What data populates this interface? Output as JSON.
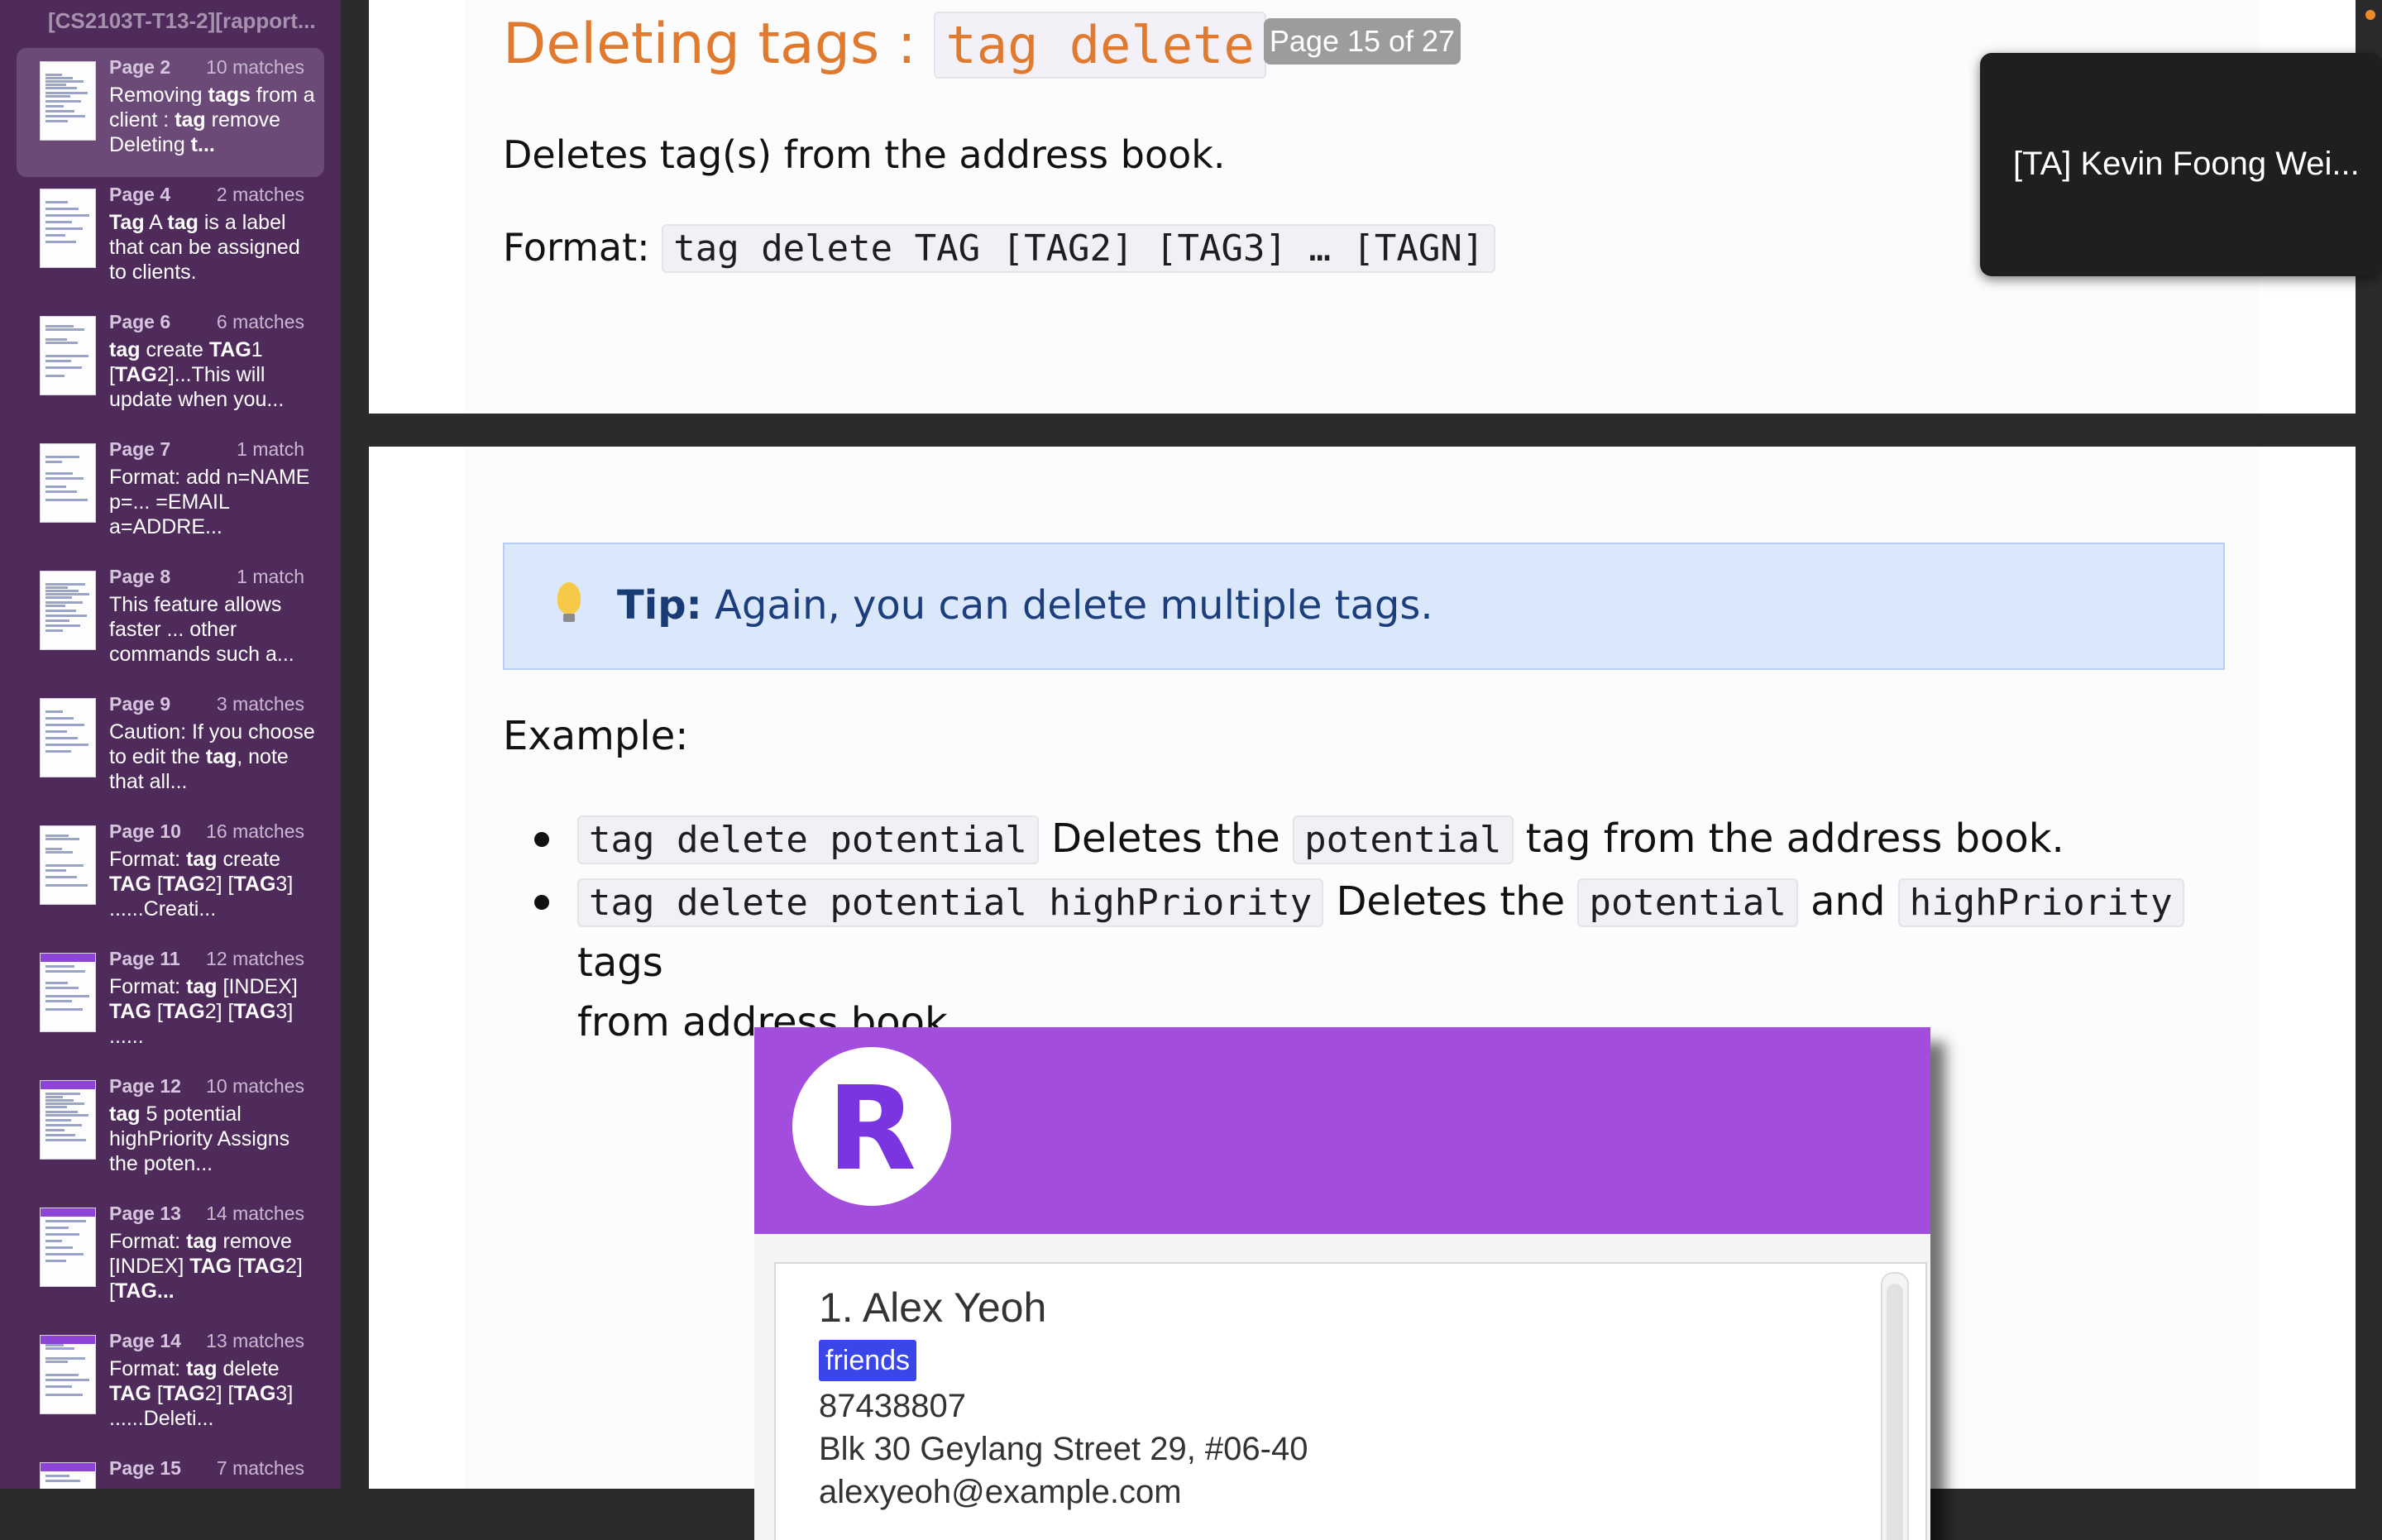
{
  "sidebar": {
    "title": "[CS2103T-T13-2][rapport...",
    "results": [
      {
        "page": "Page 2",
        "count": "10 matches",
        "snippet": "Removing <b>tags</b> from a client : <b>tag</b> remove Deleting <b>t...</b>"
      },
      {
        "page": "Page 4",
        "count": "2 matches",
        "snippet": "<b>Tag</b> A <b>tag</b> is a label that can be assigned to clients."
      },
      {
        "page": "Page 6",
        "count": "6 matches",
        "snippet": "<b>tag</b> create <b>TAG</b>1 [<b>TAG</b>2]...This will update when you..."
      },
      {
        "page": "Page 7",
        "count": "1 match",
        "snippet": "Format: add n=NAME p=... =EMAIL a=ADDRE..."
      },
      {
        "page": "Page 8",
        "count": "1 match",
        "snippet": "This feature allows faster ... other commands such a..."
      },
      {
        "page": "Page 9",
        "count": "3 matches",
        "snippet": "Caution: If you choose to edit the <b>tag</b>, note that all..."
      },
      {
        "page": "Page 10",
        "count": "16 matches",
        "snippet": "Format: <b>tag</b> create <b>TAG</b> [<b>TAG</b>2] [<b>TAG</b>3] ......Creati..."
      },
      {
        "page": "Page 11",
        "count": "12 matches",
        "snippet": "Format: <b>tag</b> [INDEX] <b>TAG</b> [<b>TAG</b>2] [<b>TAG</b>3] ......"
      },
      {
        "page": "Page 12",
        "count": "10 matches",
        "snippet": "<b>tag</b> 5 potential highPriority Assigns the poten..."
      },
      {
        "page": "Page 13",
        "count": "14 matches",
        "snippet": "Format: <b>tag</b> remove [INDEX] <b>TAG</b> [<b>TAG</b>2] [<b>TAG...</b>"
      },
      {
        "page": "Page 14",
        "count": "13 matches",
        "snippet": "Format: <b>tag</b> delete <b>TAG</b> [<b>TAG</b>2] [<b>TAG</b>3] ......Deleti..."
      },
      {
        "page": "Page 15",
        "count": "7 matches",
        "snippet": ""
      }
    ]
  },
  "document": {
    "heading_text": "Deleting tags : ",
    "heading_code": "tag delete",
    "page_indicator": "Page 15 of 27",
    "description": "Deletes tag(s) from the address book.",
    "format_label": "Format: ",
    "format_code": "tag delete TAG [TAG2] [TAG3] … [TAGN]",
    "tip_label": "Tip:",
    "tip_text": " Again, you can delete multiple tags.",
    "example_label": "Example:",
    "bullet1": {
      "code1": "tag delete potential",
      "text1": " Deletes the ",
      "code2": "potential",
      "text2": " tag from the address book."
    },
    "bullet2": {
      "code1": "tag delete potential highPriority",
      "text1": " Deletes the ",
      "code2": "potential",
      "text2": " and ",
      "code3": "highPriority",
      "text3": " tags",
      "line2": "from address book."
    }
  },
  "app_screenshot": {
    "logo_letter": "R",
    "card": {
      "name": "1.  Alex Yeoh",
      "tag": "friends",
      "phone": "87438807",
      "address": "Blk 30 Geylang Street 29, #06-40",
      "email": "alexyeoh@example.com"
    },
    "header_color": "#a34ddf"
  },
  "video_call": {
    "participant": "[TA] Kevin Foong Wei..."
  },
  "colors": {
    "sidebar_bg": "#4f2b5c",
    "heading": "#e07a2e",
    "tip_bg": "#dbe7fb",
    "tag_chip": "#3a46e8"
  }
}
